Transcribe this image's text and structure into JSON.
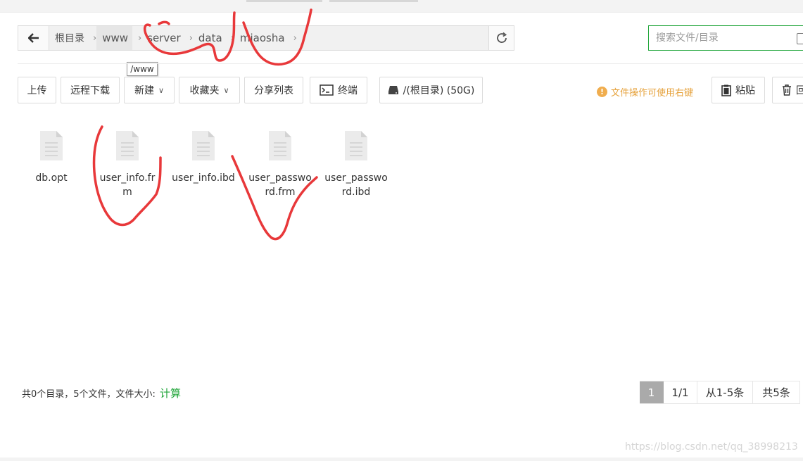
{
  "path": {
    "crumbs": [
      {
        "label": "根目录"
      },
      {
        "label": "www"
      },
      {
        "label": "server"
      },
      {
        "label": "data"
      },
      {
        "label": "miaosha"
      }
    ],
    "tooltip": "/www"
  },
  "search": {
    "placeholder": "搜索文件/目录"
  },
  "toolbar": {
    "upload": "上传",
    "remote_download": "远程下载",
    "new": "新建",
    "favorites": "收藏夹",
    "share_list": "分享列表",
    "terminal": "终端",
    "disk": "/(根目录) (50G)",
    "hint": "文件操作可使用右键",
    "paste": "粘贴",
    "recycle": "回"
  },
  "files": [
    {
      "name": "db.opt"
    },
    {
      "name": "user_info.frm"
    },
    {
      "name": "user_info.ibd"
    },
    {
      "name": "user_password.frm"
    },
    {
      "name": "user_password.ibd"
    }
  ],
  "footer": {
    "summary": "共0个目录，5个文件，文件大小:",
    "calc": "计算",
    "pager": {
      "current": "1",
      "pages": "1/1",
      "range": "从1-5条",
      "total": "共5条"
    }
  },
  "watermark": "https://blog.csdn.net/qq_38998213",
  "colors": {
    "accent": "#20a53a",
    "annotation": "#e8383a",
    "hint": "#e6a23c"
  }
}
